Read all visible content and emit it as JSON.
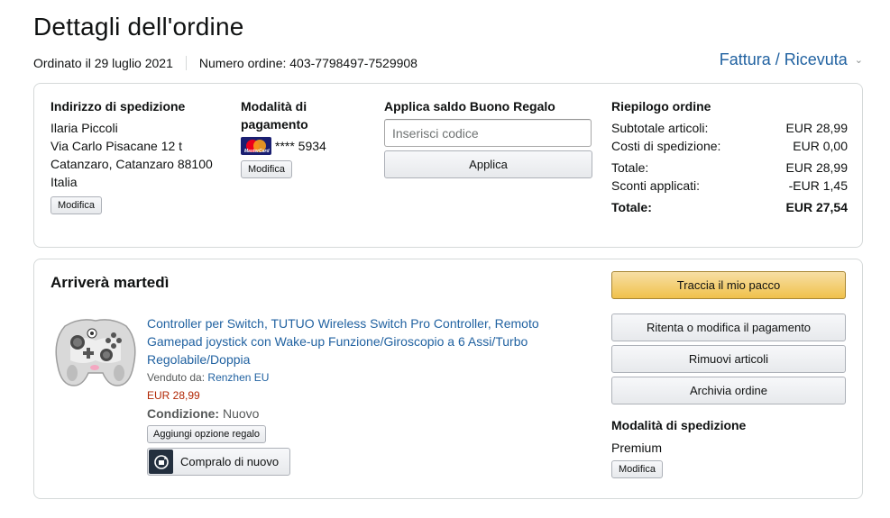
{
  "page": {
    "title": "Dettagli dell'ordine",
    "ordered_on": "Ordinato il 29 luglio 2021",
    "order_number": "Numero ordine: 403-7798497-7529908",
    "invoice_link": "Fattura / Ricevuta"
  },
  "address": {
    "heading": "Indirizzo di spedizione",
    "lines": [
      "Ilaria Piccoli",
      "Via Carlo Pisacane 12 t",
      "Catanzaro, Catanzaro 88100",
      "Italia"
    ],
    "edit_label": "Modifica"
  },
  "payment": {
    "heading": "Modalità di pagamento",
    "card_brand_text": "MasterCard",
    "card_last_digits": "**** 5934",
    "edit_label": "Modifica"
  },
  "gift": {
    "heading": "Applica saldo Buono Regalo",
    "placeholder": "Inserisci codice",
    "apply_label": "Applica"
  },
  "summary": {
    "heading": "Riepilogo ordine",
    "rows": [
      {
        "label": "Subtotale articoli:",
        "value": "EUR 28,99"
      },
      {
        "label": "Costi di spedizione:",
        "value": "EUR 0,00"
      },
      {
        "label": "Totale:",
        "value": "EUR 28,99"
      },
      {
        "label": "Sconti applicati:",
        "value": "-EUR 1,45"
      }
    ],
    "grand_total_label": "Totale:",
    "grand_total_value": "EUR 27,54"
  },
  "shipment": {
    "title": "Arriverà martedì",
    "product": {
      "title": "Controller per Switch, TUTUO Wireless Switch Pro Controller, Remoto Gamepad joystick con Wake-up Funzione/Giroscopio a 6 Assi/Turbo Regolabile/Doppia",
      "sold_by_label": "Venduto da:",
      "seller": "Renzhen EU",
      "price": "EUR 28,99",
      "condition_label": "Condizione:",
      "condition_value": "Nuovo",
      "gift_option_label": "Aggiungi opzione regalo",
      "buy_again_label": "Compralo di nuovo"
    },
    "actions": {
      "track": "Traccia il mio pacco",
      "retry_payment": "Ritenta o modifica il pagamento",
      "remove_items": "Rimuovi articoli",
      "archive": "Archivia ordine"
    },
    "shipping_method_heading": "Modalità di spedizione",
    "shipping_method": "Premium",
    "shipping_edit_label": "Modifica"
  },
  "colors": {
    "link": "#2162a1",
    "price": "#b12704",
    "primary_button": "#f0c14b"
  }
}
